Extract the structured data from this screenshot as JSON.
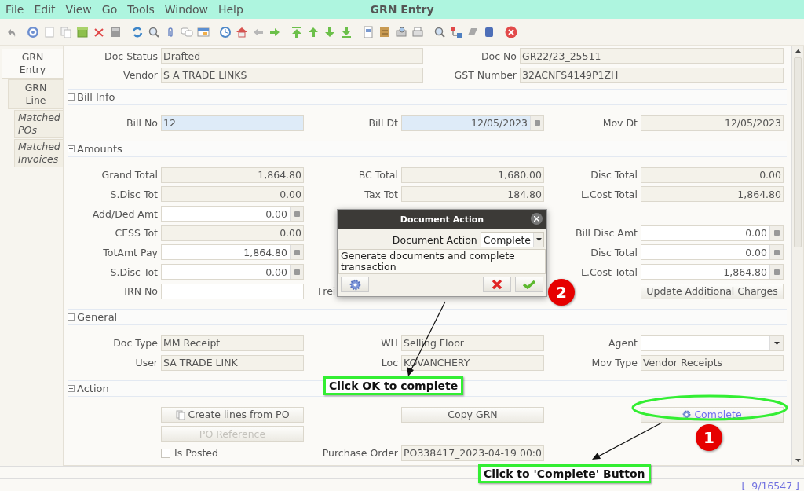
{
  "menu": [
    "File",
    "Edit",
    "View",
    "Go",
    "Tools",
    "Window",
    "Help"
  ],
  "window": {
    "title": "GRN Entry"
  },
  "tabs": [
    {
      "label": "GRN Entry",
      "selected": true,
      "italic": false,
      "children": [
        {
          "label": "GRN Line",
          "selected": false,
          "italic": false,
          "children": [
            {
              "label": "Matched POs",
              "selected": false,
              "italic": true
            },
            {
              "label": "Matched Invoices",
              "selected": false,
              "italic": true
            }
          ]
        }
      ]
    }
  ],
  "sections": [
    {
      "kind": "wide",
      "rows": [
        [
          {
            "kind": "text",
            "label": "Doc Status",
            "value": "Drafted"
          },
          {
            "kind": "text",
            "label": "Doc No",
            "value": "GR22/23_25511"
          }
        ],
        [
          {
            "kind": "text",
            "label": "Vendor",
            "value": "S A TRADE LINKS"
          },
          {
            "kind": "text",
            "label": "GST Number",
            "value": "32ACNFS4149P1ZH"
          }
        ]
      ]
    },
    {
      "kind": "grid",
      "title": "Bill Info",
      "expanded": true,
      "rows": [
        [
          {
            "kind": "input",
            "label": "Bill No",
            "value": "12",
            "mandatory": true
          },
          {
            "kind": "date",
            "label": "Bill Dt",
            "value": "12/05/2023",
            "mandatory": true
          },
          {
            "kind": "amount",
            "label": "Mov Dt",
            "value": "12/05/2023"
          }
        ]
      ]
    },
    {
      "kind": "grid",
      "title": "Amounts",
      "expanded": true,
      "rows": [
        [
          {
            "kind": "amount",
            "label": "Grand Total",
            "value": "1,864.80"
          },
          {
            "kind": "amount",
            "label": "BC Total",
            "value": "1,680.00"
          },
          {
            "kind": "amount",
            "label": "Disc Total",
            "value": "0.00"
          }
        ],
        [
          {
            "kind": "amount",
            "label": "S.Disc Tot",
            "value": "0.00"
          },
          {
            "kind": "amount",
            "label": "Tax Tot",
            "value": "184.80"
          },
          {
            "kind": "amount",
            "label": "L.Cost Total",
            "value": "1,864.80"
          }
        ],
        [
          {
            "kind": "amount_input",
            "label": "Add/Ded Amt",
            "value": "0.00"
          },
          {
            "kind": "empty"
          },
          {
            "kind": "empty"
          }
        ],
        [
          {
            "kind": "amount",
            "label": "CESS Tot",
            "value": "0.00"
          },
          {
            "kind": "empty"
          },
          {
            "kind": "amount_input",
            "label": "Bill Disc Amt",
            "value": "0.00"
          }
        ],
        [
          {
            "kind": "amount_input",
            "label": "TotAmt Pay",
            "value": "1,864.80"
          },
          {
            "kind": "empty"
          },
          {
            "kind": "amount_input",
            "label": "Disc Total",
            "value": "0.00"
          }
        ],
        [
          {
            "kind": "amount_input",
            "label": "S.Disc Tot",
            "value": "0.00"
          },
          {
            "kind": "empty"
          },
          {
            "kind": "amount_input",
            "label": "L.Cost Total",
            "value": "1,864.80"
          }
        ],
        [
          {
            "kind": "input",
            "label": "IRN No",
            "mandatory": false
          },
          {
            "kind": "label_only",
            "label": "Frei"
          },
          {
            "kind": "button",
            "text": "Update Additional Charges",
            "disabled": false
          }
        ]
      ]
    },
    {
      "kind": "grid",
      "title": "General",
      "expanded": true,
      "rows": [
        [
          {
            "kind": "text",
            "label": "Doc Type",
            "value": "MM Receipt"
          },
          {
            "kind": "text",
            "label": "WH",
            "value": "Selling Floor"
          },
          {
            "kind": "combo",
            "label": "Agent"
          }
        ],
        [
          {
            "kind": "text",
            "label": "User",
            "value": "SA TRADE LINK"
          },
          {
            "kind": "text",
            "label": "Loc",
            "value": "KOVANCHERY"
          },
          {
            "kind": "text",
            "label": "Mov Type",
            "value": "Vendor Receipts"
          }
        ]
      ]
    },
    {
      "kind": "grid",
      "title": "Action",
      "expanded": true,
      "rows": [
        [
          {
            "kind": "copy_button",
            "text": "Create lines from PO",
            "disabled": false
          },
          {
            "kind": "button",
            "text": "Copy GRN",
            "disabled": false
          },
          {
            "kind": "process",
            "text": "Complete"
          }
        ],
        [
          {
            "kind": "button",
            "text": "PO Reference",
            "disabled": true
          },
          {
            "kind": "empty"
          },
          {
            "kind": "empty"
          }
        ],
        [
          {
            "kind": "checkbox",
            "text": "Is Posted",
            "checked": false
          },
          {
            "kind": "text",
            "label": "Purchase Order",
            "value": "PO338417_2023-04-19 00:0"
          },
          {
            "kind": "empty"
          }
        ]
      ]
    }
  ],
  "dialog": {
    "title": "Document Action",
    "label": "Document Action",
    "value": "Complete",
    "description": "Generate documents and complete transaction"
  },
  "annotations": [
    {
      "kind": "badge",
      "text": "2"
    },
    {
      "kind": "callout",
      "text": "Click OK to complete"
    },
    {
      "kind": "badge",
      "text": "1"
    },
    {
      "kind": "callout",
      "text": "Click to 'Complete' Button"
    }
  ],
  "status_bar": {
    "record": "[  9/16547 ]"
  }
}
